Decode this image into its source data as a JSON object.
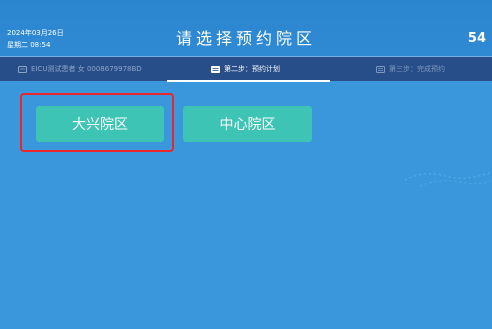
{
  "header": {
    "date": "2024年03月26日",
    "weekday_time": "星期二 08:54",
    "title": "请选择预约院区",
    "countdown": "54"
  },
  "steps": [
    {
      "label": "EICU测试患者  女  0008679978BD",
      "icon": "id-card-icon",
      "state": "done"
    },
    {
      "label": "第二步：预约计划",
      "icon": "calendar-icon",
      "state": "active"
    },
    {
      "label": "第三步：完成预约",
      "icon": "checklist-icon",
      "state": "pending"
    }
  ],
  "campuses": [
    {
      "label": "大兴院区",
      "selected": true
    },
    {
      "label": "中心院区",
      "selected": false
    }
  ],
  "colors": {
    "background": "#3a97dc",
    "header": "#2f8ad3",
    "step_bar": "#284e8a",
    "button": "#3dc4b5",
    "highlight": "#e8262b"
  }
}
